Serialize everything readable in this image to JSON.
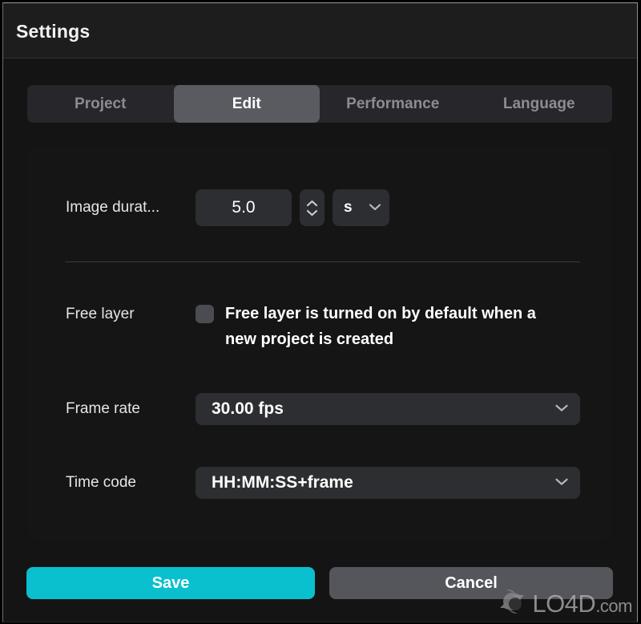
{
  "window": {
    "title": "Settings"
  },
  "tabs": [
    {
      "label": "Project",
      "active": false
    },
    {
      "label": "Edit",
      "active": true
    },
    {
      "label": "Performance",
      "active": false
    },
    {
      "label": "Language",
      "active": false
    }
  ],
  "settings": {
    "image_duration": {
      "label": "Image durat...",
      "value": "5.0",
      "unit": "s",
      "stepper_icon": "spinner-up-down-icon",
      "unit_chevron_icon": "chevron-down-icon"
    },
    "free_layer": {
      "label": "Free layer",
      "checked": false,
      "caption": "Free layer is turned on by default when a new project is created",
      "checkbox_icon": "checkbox-unchecked-icon"
    },
    "frame_rate": {
      "label": "Frame rate",
      "value": "30.00 fps",
      "chevron_icon": "chevron-down-icon"
    },
    "time_code": {
      "label": "Time code",
      "value": "HH:MM:SS+frame",
      "chevron_icon": "chevron-down-icon"
    }
  },
  "footer": {
    "save_label": "Save",
    "cancel_label": "Cancel"
  },
  "watermark": {
    "name": "LO4D",
    "suffix": ".com",
    "logo_icon": "refresh-circle-icon"
  },
  "colors": {
    "accent": "#0ac0cf",
    "cancel": "#54565b",
    "tab_active": "#5a5b60",
    "tab_bar": "#26262b",
    "panel": "#151515",
    "field": "#2d2e31",
    "titlebar": "#1d1d1d",
    "window": "#141414"
  }
}
